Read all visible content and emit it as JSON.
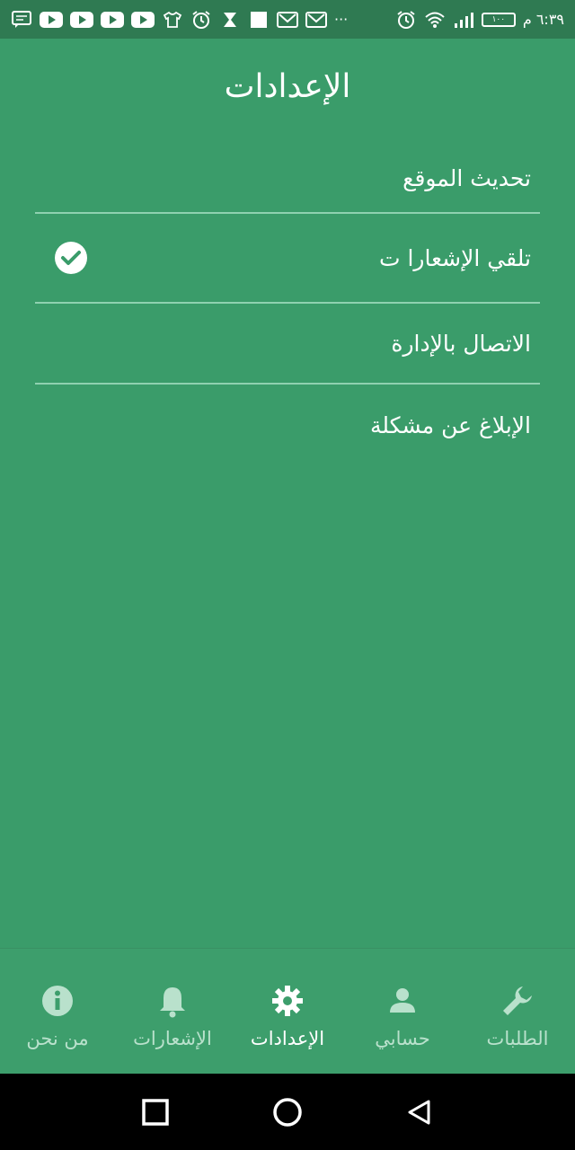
{
  "status_bar": {
    "time": "٦:٣٩ م",
    "battery": "١٠٠",
    "more": "···",
    "icons": [
      "message-icon",
      "youtube-icon",
      "youtube-icon",
      "youtube-icon",
      "youtube-icon",
      "shirt-icon",
      "alarm-icon",
      "hourglass-icon",
      "square-icon",
      "mail-icon",
      "mail-icon",
      "alarm-icon",
      "wifi-icon",
      "signal-icon",
      "battery-icon"
    ]
  },
  "header": {
    "title": "الإعدادات"
  },
  "settings": {
    "items": [
      {
        "label": "تحديث الموقع"
      },
      {
        "label": "تلقي الإشعارا ت",
        "checked": true
      },
      {
        "label": "الاتصال بالإدارة"
      },
      {
        "label": "الإبلاغ عن مشكلة"
      }
    ]
  },
  "bottom_nav": {
    "items": [
      {
        "label": "الطلبات",
        "icon": "wrench-icon"
      },
      {
        "label": "حسابي",
        "icon": "person-icon"
      },
      {
        "label": "الإعدادات",
        "icon": "gear-icon",
        "active": true
      },
      {
        "label": "الإشعارات",
        "icon": "bell-icon"
      },
      {
        "label": "من نحن",
        "icon": "info-icon"
      }
    ]
  },
  "colors": {
    "background": "#3a9c6a",
    "status_bar": "#2f7a52",
    "inactive_nav": "#b9e1cc",
    "active_nav": "#ffffff"
  }
}
